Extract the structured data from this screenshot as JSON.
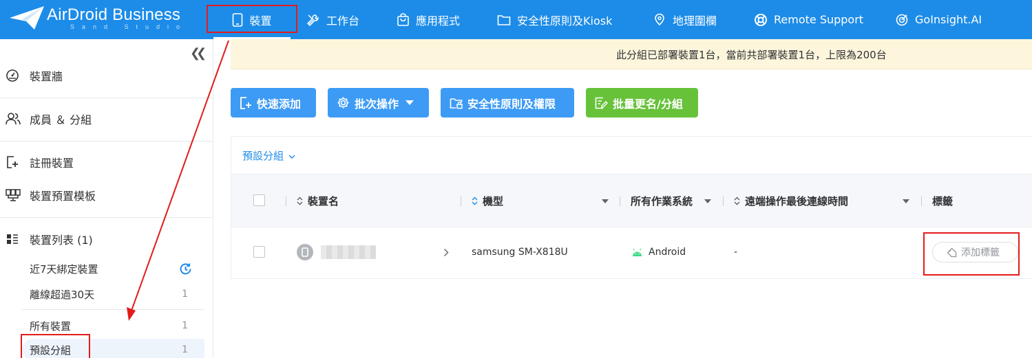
{
  "brand": {
    "name": "AirDroid Business",
    "subtitle": "Sand Studio"
  },
  "nav": {
    "items": [
      {
        "label": "裝置",
        "icon": "tablet-icon"
      },
      {
        "label": "工作台",
        "icon": "tools-icon"
      },
      {
        "label": "應用程式",
        "icon": "shopping-bag-icon"
      },
      {
        "label": "安全性原則及Kiosk",
        "icon": "folder-icon"
      },
      {
        "label": "地理圍欄",
        "icon": "map-pin-icon"
      },
      {
        "label": "Remote Support",
        "icon": "lifebuoy-icon"
      },
      {
        "label": "GoInsight.AI",
        "icon": "goinsight-icon"
      }
    ],
    "active_index": 0
  },
  "sidebar": {
    "items": [
      {
        "label": "裝置牆",
        "icon": "dashboard-icon"
      },
      {
        "label": "成員 ＆ 分組",
        "icon": "users-icon"
      },
      {
        "label": "註冊裝置",
        "icon": "enroll-device-icon"
      },
      {
        "label": "裝置預置模板",
        "icon": "template-icon"
      },
      {
        "label": "裝置列表 (1)",
        "icon": "list-icon"
      }
    ],
    "sub_items": [
      {
        "label": "近7天綁定裝置",
        "count": ""
      },
      {
        "label": "離線超過30天",
        "count": "1"
      },
      {
        "label": "所有裝置",
        "count": "1"
      },
      {
        "label": "預設分組",
        "count": "1"
      }
    ]
  },
  "banner": {
    "text": "此分組已部署裝置1台，當前共部署裝置1台，上限為200台"
  },
  "toolbar": {
    "quick_add": "快速添加",
    "batch": "批次操作",
    "policy": "安全性原則及權限",
    "rename": "批量更名/分組"
  },
  "group_selector": "預設分組",
  "table": {
    "columns": {
      "name": "裝置名",
      "model": "機型",
      "os": "所有作業系統",
      "last_conn": "遠端操作最後連線時間",
      "tags": "標籤"
    },
    "rows": [
      {
        "model": "samsung SM-X818U",
        "os": "Android",
        "last_conn": "-",
        "tag_button": "添加標籤"
      }
    ]
  },
  "colors": {
    "topbar": "#1d8ce8",
    "button_blue": "#3d9bf5",
    "button_green": "#67c23a",
    "banner_bg": "#fdf6dd",
    "annotation_red": "#e31b1b",
    "android_green": "#3ddc84"
  }
}
